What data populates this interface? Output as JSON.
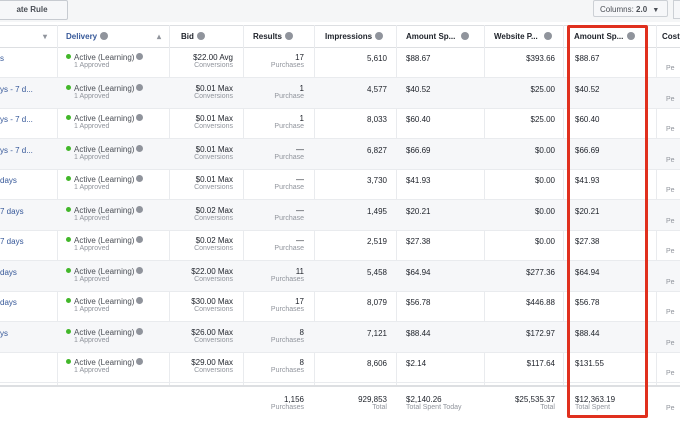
{
  "toolbar": {
    "create_rule_label": "ate Rule",
    "columns_label": "Columns:",
    "columns_value": "2.0"
  },
  "headers": {
    "name_caret": "▾",
    "delivery": "Delivery",
    "bid": "Bid",
    "results": "Results",
    "impressions": "Impressions",
    "amount_spent": "Amount Sp...",
    "website_p": "Website P...",
    "amount_spent_2": "Amount Sp...",
    "cost": "Cost"
  },
  "rows": [
    {
      "name": "s",
      "status": "Active (Learning)",
      "approved": "1 Approved",
      "bid": "$22.00 Avg",
      "bid_sub": "Conversions",
      "results": "17",
      "results_sub": "Purchases",
      "impressions": "5,610",
      "amount": "$88.67",
      "website": "$393.66",
      "amount2": "$88.67",
      "cost": "Pe"
    },
    {
      "name": "ys - 7 d...",
      "status": "Active (Learning)",
      "approved": "1 Approved",
      "bid": "$0.01 Max",
      "bid_sub": "Conversions",
      "results": "1",
      "results_sub": "Purchase",
      "impressions": "4,577",
      "amount": "$40.52",
      "website": "$25.00",
      "amount2": "$40.52",
      "cost": "Pe"
    },
    {
      "name": "ys - 7 d...",
      "status": "Active (Learning)",
      "approved": "1 Approved",
      "bid": "$0.01 Max",
      "bid_sub": "Conversions",
      "results": "1",
      "results_sub": "Purchase",
      "impressions": "8,033",
      "amount": "$60.40",
      "website": "$25.00",
      "amount2": "$60.40",
      "cost": "Pe"
    },
    {
      "name": "ys - 7 d...",
      "status": "Active (Learning)",
      "approved": "1 Approved",
      "bid": "$0.01 Max",
      "bid_sub": "Conversions",
      "results": "—",
      "results_sub": "Purchase",
      "impressions": "6,827",
      "amount": "$66.69",
      "website": "$0.00",
      "amount2": "$66.69",
      "cost": "Pe"
    },
    {
      "name": "days",
      "status": "Active (Learning)",
      "approved": "1 Approved",
      "bid": "$0.01 Max",
      "bid_sub": "Conversions",
      "results": "—",
      "results_sub": "Purchase",
      "impressions": "3,730",
      "amount": "$41.93",
      "website": "$0.00",
      "amount2": "$41.93",
      "cost": "Pe"
    },
    {
      "name": "7 days",
      "status": "Active (Learning)",
      "approved": "1 Approved",
      "bid": "$0.02 Max",
      "bid_sub": "Conversions",
      "results": "—",
      "results_sub": "Purchase",
      "impressions": "1,495",
      "amount": "$20.21",
      "website": "$0.00",
      "amount2": "$20.21",
      "cost": "Pe"
    },
    {
      "name": "7 days",
      "status": "Active (Learning)",
      "approved": "1 Approved",
      "bid": "$0.02 Max",
      "bid_sub": "Conversions",
      "results": "—",
      "results_sub": "Purchase",
      "impressions": "2,519",
      "amount": "$27.38",
      "website": "$0.00",
      "amount2": "$27.38",
      "cost": "Pe"
    },
    {
      "name": "days",
      "status": "Active (Learning)",
      "approved": "1 Approved",
      "bid": "$22.00 Max",
      "bid_sub": "Conversions",
      "results": "11",
      "results_sub": "Purchases",
      "impressions": "5,458",
      "amount": "$64.94",
      "website": "$277.36",
      "amount2": "$64.94",
      "cost": "Pe"
    },
    {
      "name": "days",
      "status": "Active (Learning)",
      "approved": "1 Approved",
      "bid": "$30.00 Max",
      "bid_sub": "Conversions",
      "results": "17",
      "results_sub": "Purchases",
      "impressions": "8,079",
      "amount": "$56.78",
      "website": "$446.88",
      "amount2": "$56.78",
      "cost": "Pe"
    },
    {
      "name": "ys",
      "status": "Active (Learning)",
      "approved": "1 Approved",
      "bid": "$26.00 Max",
      "bid_sub": "Conversions",
      "results": "8",
      "results_sub": "Purchases",
      "impressions": "7,121",
      "amount": "$88.44",
      "website": "$172.97",
      "amount2": "$88.44",
      "cost": "Pe"
    },
    {
      "name": "",
      "status": "Active (Learning)",
      "approved": "1 Approved",
      "bid": "$29.00 Max",
      "bid_sub": "Conversions",
      "results": "8",
      "results_sub": "Purchases",
      "impressions": "8,606",
      "amount": "$2.14",
      "website": "$117.64",
      "amount2": "$131.55",
      "cost": "Pe"
    }
  ],
  "totals": {
    "results": "1,156",
    "results_sub": "Purchases",
    "impressions": "929,853",
    "impressions_sub": "Total",
    "amount": "$2,140.26",
    "amount_sub": "Total Spent Today",
    "website": "$25,535.37",
    "website_sub": "Total",
    "amount2": "$12,363.19",
    "amount2_sub": "Total Spent",
    "cost": "Pe"
  },
  "colors": {
    "accent": "#365899",
    "highlight": "#e0301e",
    "active_dot": "#42b72a"
  }
}
